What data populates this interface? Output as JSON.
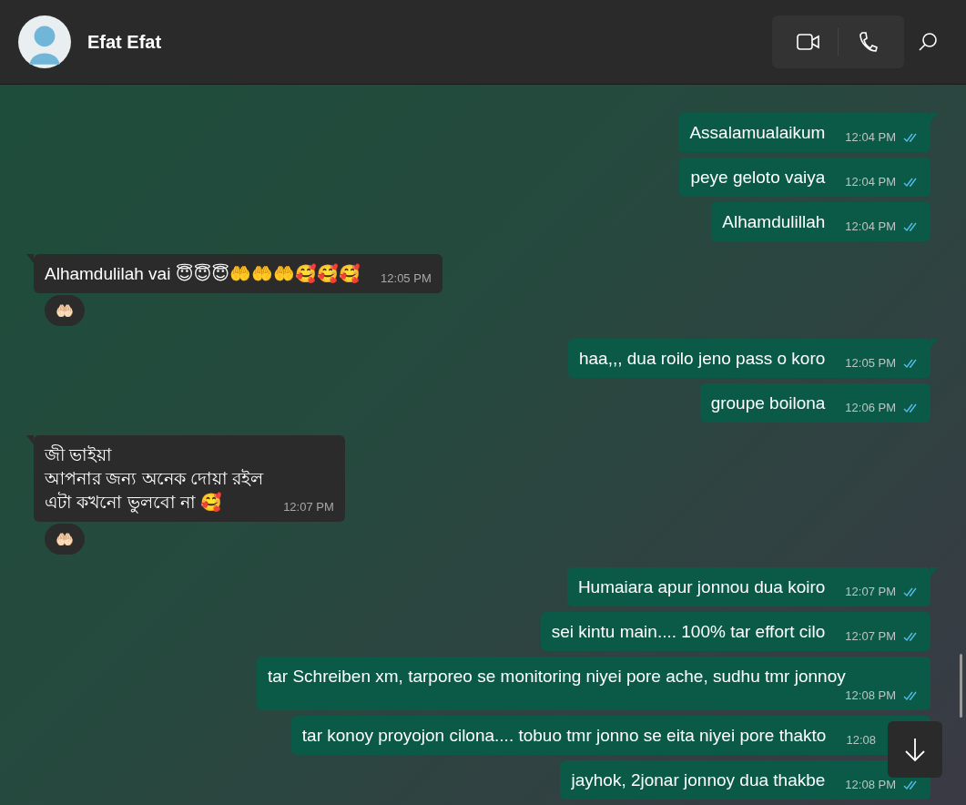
{
  "header": {
    "name": "Efat Efat"
  },
  "groups": [
    {
      "kind": "out",
      "messages": [
        {
          "text": "Assalamualaikum",
          "time": "12:04 PM",
          "read": true
        },
        {
          "text": "peye geloto vaiya",
          "time": "12:04 PM",
          "read": true
        },
        {
          "text": "Alhamdulillah",
          "time": "12:04 PM",
          "read": true
        }
      ]
    },
    {
      "kind": "in",
      "messages": [
        {
          "text": "Alhamdulilah vai 😇😇😇🤲🤲🤲🥰🥰🥰",
          "time": "12:05 PM",
          "reaction": "🤲🏻"
        }
      ]
    },
    {
      "kind": "out",
      "messages": [
        {
          "text": "haa,,, dua roilo jeno pass o koro",
          "time": "12:05 PM",
          "read": true
        },
        {
          "text": "groupe boilona",
          "time": "12:06 PM",
          "read": true
        }
      ]
    },
    {
      "kind": "in",
      "messages": [
        {
          "text": "জী ভাইয়া\nআপনার জন্য অনেক দোয়া রইল\nএটা কখনো ভুলবো না 🥰",
          "time": "12:07 PM",
          "reaction": "🤲🏻"
        }
      ]
    },
    {
      "kind": "out",
      "messages": [
        {
          "text": "Humaiara apur jonnou dua koiro",
          "time": "12:07 PM",
          "read": true
        },
        {
          "text": "sei kintu main.... 100% tar effort cilo",
          "time": "12:07 PM",
          "read": true
        },
        {
          "text": "tar Schreiben xm, tarporeo se monitoring niyei pore ache, sudhu tmr jonnoy",
          "time": "12:08 PM",
          "read": true
        },
        {
          "text": "tar konoy proyojon cilona.... tobuo tmr jonno se eita niyei pore thakto",
          "time": "12:08"
        },
        {
          "text": "jayhok, 2jonar jonnoy dua thakbe",
          "time": "12:08 PM",
          "read": true
        }
      ]
    }
  ]
}
